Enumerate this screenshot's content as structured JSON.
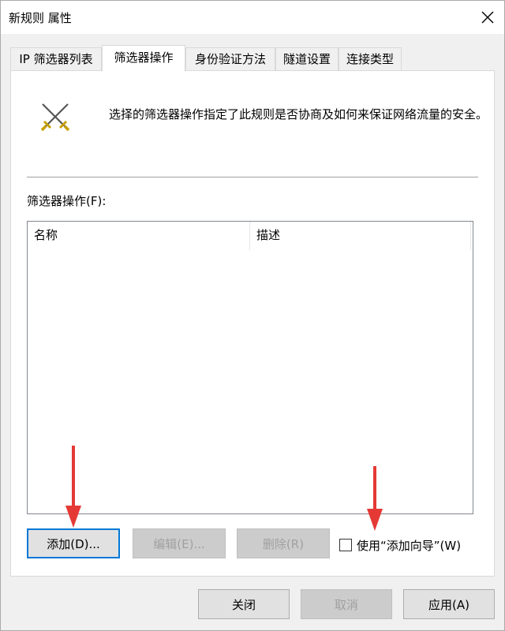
{
  "window": {
    "title": "新规则 属性"
  },
  "tabs": [
    {
      "label": "IP 筛选器列表"
    },
    {
      "label": "筛选器操作"
    },
    {
      "label": "身份验证方法"
    },
    {
      "label": "隧道设置"
    },
    {
      "label": "连接类型"
    }
  ],
  "panel": {
    "description": "选择的筛选器操作指定了此规则是否协商及如何来保证网络流量的安全。",
    "list_label": "筛选器操作(F):",
    "columns": [
      {
        "label": "名称"
      },
      {
        "label": "描述"
      }
    ],
    "buttons": {
      "add": "添加(D)...",
      "edit": "编辑(E)...",
      "remove": "删除(R)"
    },
    "wizard_checkbox": {
      "label": "使用“添加向导”(W)",
      "checked": false
    }
  },
  "footer": {
    "close": "关闭",
    "cancel": "取消",
    "apply": "应用(A)"
  },
  "colors": {
    "accent": "#0078d7",
    "annotation_arrow": "#e53935"
  },
  "icons": {
    "dialog": "crossed-swords-icon",
    "close": "close-icon"
  }
}
